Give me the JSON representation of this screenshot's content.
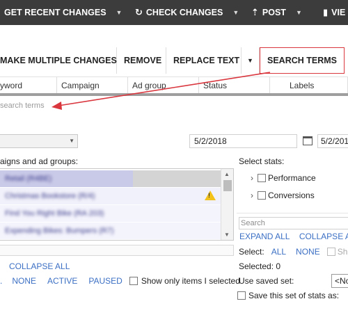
{
  "toolbar": {
    "get_recent_changes": "GET RECENT CHANGES",
    "check_changes": "CHECK CHANGES",
    "post": "POST",
    "view": "VIE"
  },
  "actions": {
    "make_multiple_changes": "MAKE MULTIPLE CHANGES",
    "remove": "REMOVE",
    "replace_text": "REPLACE TEXT",
    "search_terms": "SEARCH TERMS"
  },
  "columns": [
    "yword",
    "Campaign",
    "Ad group",
    "Status",
    "Labels"
  ],
  "search_terms_hint": "search terms",
  "dates": {
    "start": "5/2/2018",
    "end": "5/2/201"
  },
  "left_panel": {
    "title": "aigns and ad groups:",
    "rows": [
      "Retail (R4BE)",
      "Christmas Bookstore (R/4)",
      "Find You Right Bike (RA 203)",
      "Expending Bikes: Bumpers (R7)"
    ],
    "collapse_all": "COLLAPSE ALL",
    "links": {
      "none": "NONE",
      "active": "ACTIVE",
      "paused": "PAUSED"
    },
    "show_only_selected": "Show only items I selected"
  },
  "right_panel": {
    "select_stats": "Select stats:",
    "stats": [
      "Performance",
      "Conversions"
    ],
    "search_placeholder": "Search",
    "expand_all": "EXPAND ALL",
    "collapse_all": "COLLAPSE ALL",
    "select_label": "Select:",
    "all": "ALL",
    "none": "NONE",
    "show_truncated": "Sh",
    "selected": "Selected: 0",
    "use_saved_set": "Use saved set:",
    "saved_set_value": "<No",
    "save_this_set": "Save this set of stats as:"
  },
  "colors": {
    "toolbar_bg": "#3c3c3c",
    "link_blue": "#3b6fc4",
    "highlight_red": "#d9363e",
    "selected_row": "#c9c9e8",
    "warning": "#f2c21b"
  },
  "icons": [
    "refresh-icon",
    "upload-icon",
    "bar-chart-icon",
    "calendar-icon",
    "warning-icon",
    "chevron-right-icon",
    "chevron-down-icon"
  ]
}
